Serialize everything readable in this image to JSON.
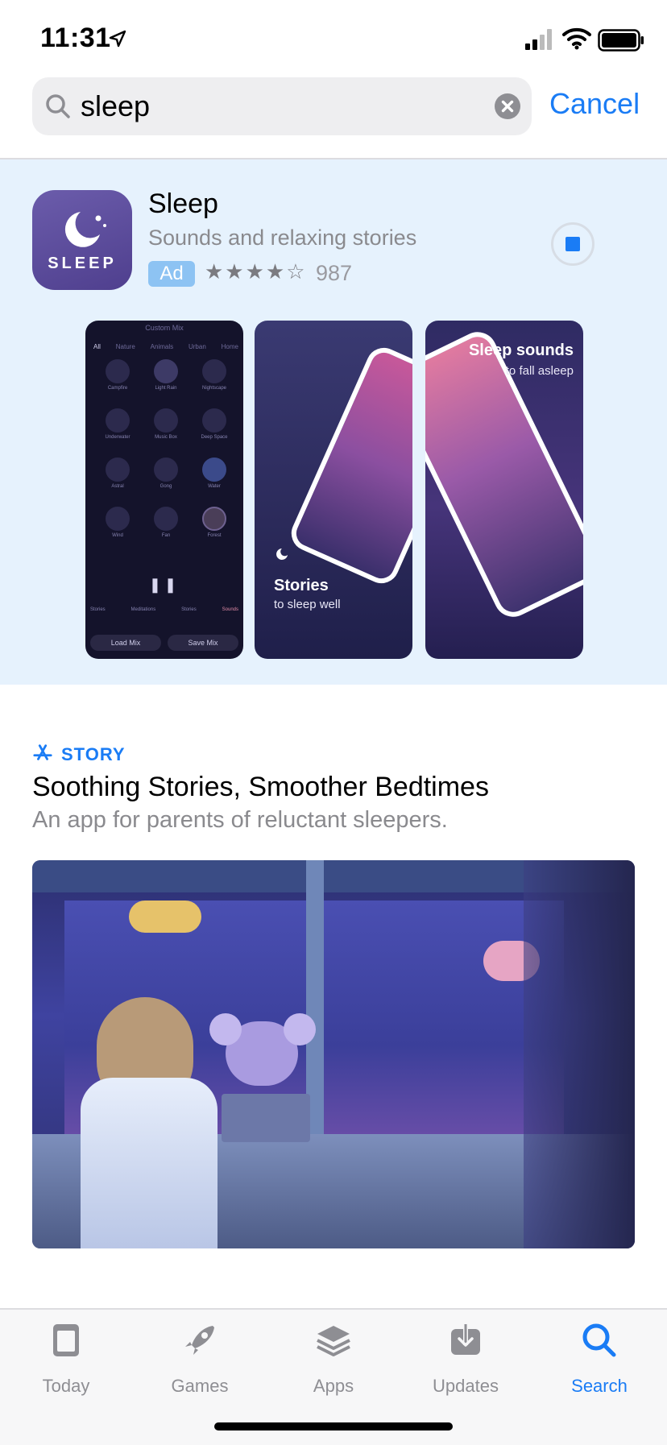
{
  "status_bar": {
    "time": "11:31"
  },
  "search": {
    "value": "sleep",
    "cancel_label": "Cancel"
  },
  "ad": {
    "app_name": "Sleep",
    "subtitle": "Sounds and relaxing stories",
    "badge": "Ad",
    "stars_glyph": "★★★★☆",
    "rating_count": "987",
    "icon_text": "SLEEP",
    "screenshots": [
      {
        "header": "Custom Mix",
        "tabs": [
          "All",
          "Nature",
          "Animals",
          "Urban",
          "Home"
        ],
        "sounds": [
          "Campfire",
          "Light Rain",
          "Nightscape",
          "Underwater",
          "Music Box",
          "Deep Space",
          "Astral",
          "Gong",
          "Water",
          "Wind",
          "Fan",
          "Forest"
        ],
        "nav": [
          "Stories",
          "Meditations",
          "Stories",
          "Sounds"
        ],
        "buttons": [
          "Load Mix",
          "Save Mix"
        ]
      },
      {
        "title": "Stories",
        "subtitle": "to sleep well"
      },
      {
        "title": "Sleep sounds",
        "subtitle": "to fall asleep"
      }
    ]
  },
  "story": {
    "tag": "STORY",
    "title": "Soothing Stories, Smoother Bedtimes",
    "subtitle": "An app for parents of reluctant sleepers."
  },
  "tabbar": {
    "items": [
      {
        "label": "Today",
        "icon": "today-icon"
      },
      {
        "label": "Games",
        "icon": "rocket-icon"
      },
      {
        "label": "Apps",
        "icon": "apps-stack-icon"
      },
      {
        "label": "Updates",
        "icon": "download-icon"
      },
      {
        "label": "Search",
        "icon": "search-icon",
        "active": true
      }
    ]
  },
  "colors": {
    "accent": "#1a7cf5",
    "ad_background": "#e6f2fd",
    "icon_purple": "#5b4a9a"
  }
}
